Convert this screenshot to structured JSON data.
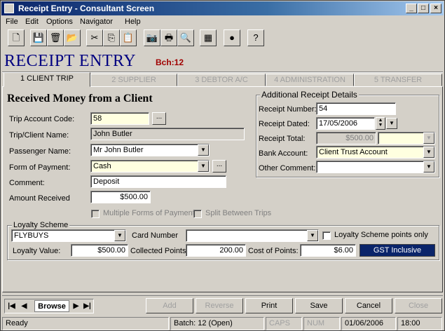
{
  "window": {
    "title": "Receipt Entry - Consultant Screen",
    "minimize": "_",
    "maximize": "□",
    "close": "×"
  },
  "menu": [
    "File",
    "Edit",
    "Options",
    "Navigator",
    "Help"
  ],
  "header": {
    "title": "RECEIPT ENTRY",
    "batch": "Bch:12"
  },
  "tabs": [
    {
      "label": "1 CLIENT TRIP"
    },
    {
      "label": "2 SUPPLIER"
    },
    {
      "label": "3 DEBTOR A/C"
    },
    {
      "label": "4 ADMINISTRATION"
    },
    {
      "label": "5 TRANSFER"
    }
  ],
  "client": {
    "heading": "Received Money from a Client",
    "trip_account_label": "Trip Account Code:",
    "trip_account_value": "58",
    "client_name_label": "Trip/Client Name:",
    "client_name_value": "John Butler",
    "passenger_label": "Passenger Name:",
    "passenger_value": "Mr John Butler",
    "payment_label": "Form of Payment:",
    "payment_value": "Cash",
    "comment_label": "Comment:",
    "comment_value": "Deposit",
    "amount_label": "Amount Received",
    "amount_value": "$500.00",
    "multiple_forms": "Multiple Forms of Payment",
    "split_trips": "Split Between Trips",
    "ellipsis": "..."
  },
  "details": {
    "title": "Additional Receipt Details",
    "number_label": "Receipt Number:",
    "number_value": "54",
    "dated_label": "Receipt Dated:",
    "dated_value": "17/05/2006",
    "total_label": "Receipt Total:",
    "total_value": "$500.00",
    "bank_label": "Bank Account:",
    "bank_value": "Client Trust Account",
    "other_label": "Other Comment:",
    "other_value": ""
  },
  "loyalty": {
    "title": "Loyalty Scheme",
    "scheme_value": "FLYBUYS",
    "card_label": "Card Number",
    "card_value": "",
    "points_only": "Loyalty Scheme points only",
    "value_label": "Loyalty Value:",
    "value_value": "$500.00",
    "collected_label": "Collected Points:",
    "collected_value": "200.00",
    "cost_label": "Cost of Points:",
    "cost_value": "$6.00",
    "gst": "GST Inclusive"
  },
  "navigator": {
    "label": "Browse"
  },
  "actions": [
    "Add",
    "Reverse",
    "Print",
    "Save",
    "Cancel",
    "Close"
  ],
  "status": {
    "ready": "Ready",
    "batch": "Batch: 12 (Open)",
    "caps": "CAPS",
    "num": "NUM",
    "date": "01/06/2006",
    "time": "18:00"
  }
}
